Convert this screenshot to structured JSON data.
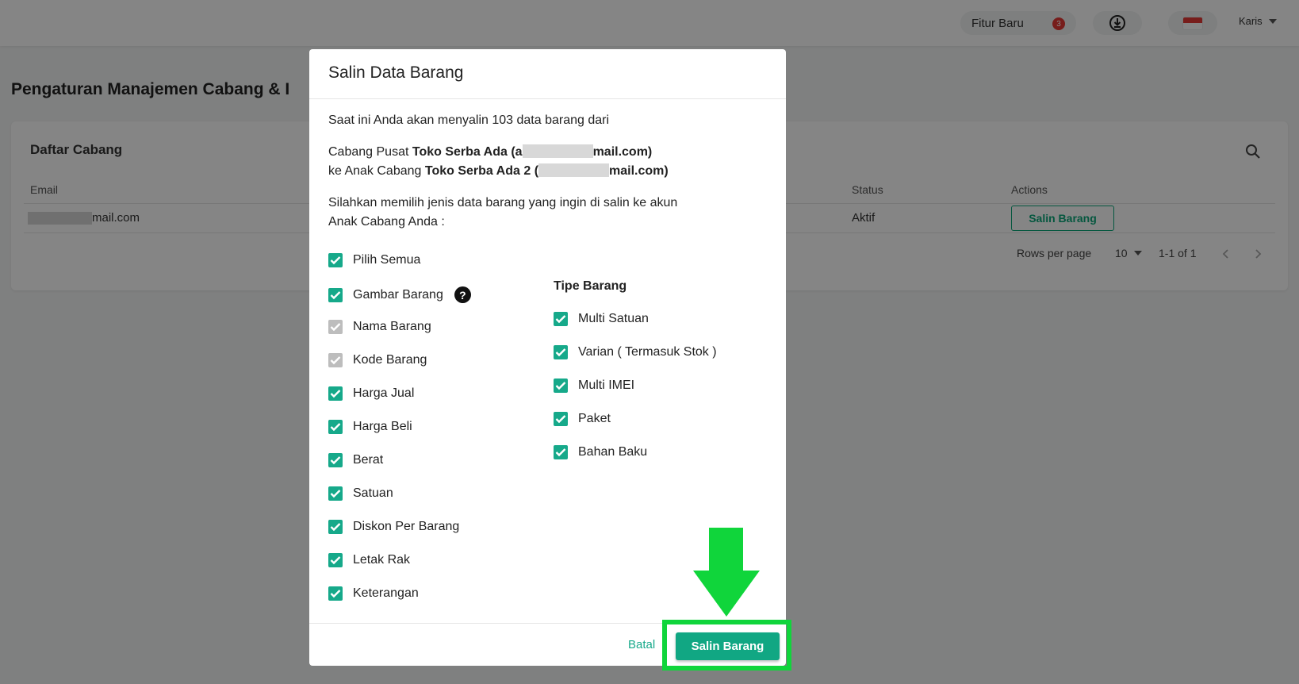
{
  "topbar": {
    "fitur_label": "Fitur Baru",
    "fitur_badge": "3",
    "user_name": "Karis",
    "icons": [
      "download-icon",
      "flag-indonesia-icon",
      "chevron-down-icon"
    ]
  },
  "page": {
    "title": "Pengaturan Manajemen Cabang & I"
  },
  "card": {
    "title": "Daftar Cabang",
    "columns": {
      "email": "Email",
      "status": "Status",
      "actions": "Actions"
    },
    "row": {
      "email_suffix": "mail.com",
      "status": "Aktif",
      "action_label": "Salin Barang"
    },
    "pager": {
      "rows_label": "Rows per page",
      "rows_value": "10",
      "range": "1-1 of 1"
    }
  },
  "modal": {
    "title": "Salin Data Barang",
    "intro": "Saat ini Anda akan menyalin 103 data barang dari",
    "line1_prefix": "Cabang Pusat ",
    "line1_name": "Toko Serba Ada (a",
    "line1_suffix": "mail.com)",
    "line2_prefix": "ke Anak Cabang ",
    "line2_name": "Toko Serba Ada 2 (",
    "line2_suffix": "mail.com)",
    "instruction_1": "Silahkan memilih jenis data barang yang ingin di salin ke akun",
    "instruction_2": "Anak Cabang Anda :",
    "left_options": [
      {
        "label": "Pilih Semua",
        "checked": true,
        "disabled": false
      },
      {
        "label": "Gambar Barang",
        "checked": true,
        "disabled": false
      },
      {
        "label": "Nama Barang",
        "checked": true,
        "disabled": true
      },
      {
        "label": "Kode Barang",
        "checked": true,
        "disabled": true
      },
      {
        "label": "Harga Jual",
        "checked": true,
        "disabled": false
      },
      {
        "label": "Harga Beli",
        "checked": true,
        "disabled": false
      },
      {
        "label": "Berat",
        "checked": true,
        "disabled": false
      },
      {
        "label": "Satuan",
        "checked": true,
        "disabled": false
      },
      {
        "label": "Diskon Per Barang",
        "checked": true,
        "disabled": false
      },
      {
        "label": "Letak Rak",
        "checked": true,
        "disabled": false
      },
      {
        "label": "Keterangan",
        "checked": true,
        "disabled": false
      }
    ],
    "tipe_heading": "Tipe Barang",
    "right_options": [
      {
        "label": "Multi Satuan",
        "checked": true
      },
      {
        "label": "Varian ( Termasuk Stok )",
        "checked": true
      },
      {
        "label": "Multi IMEI",
        "checked": true
      },
      {
        "label": "Paket",
        "checked": true
      },
      {
        "label": "Bahan Baku",
        "checked": true
      }
    ],
    "help_glyph": "?",
    "cancel_label": "Batal",
    "submit_label": "Salin Barang"
  },
  "colors": {
    "accent": "#11a783",
    "annotation": "#10d53b",
    "disabled": "#bdbdbd"
  }
}
